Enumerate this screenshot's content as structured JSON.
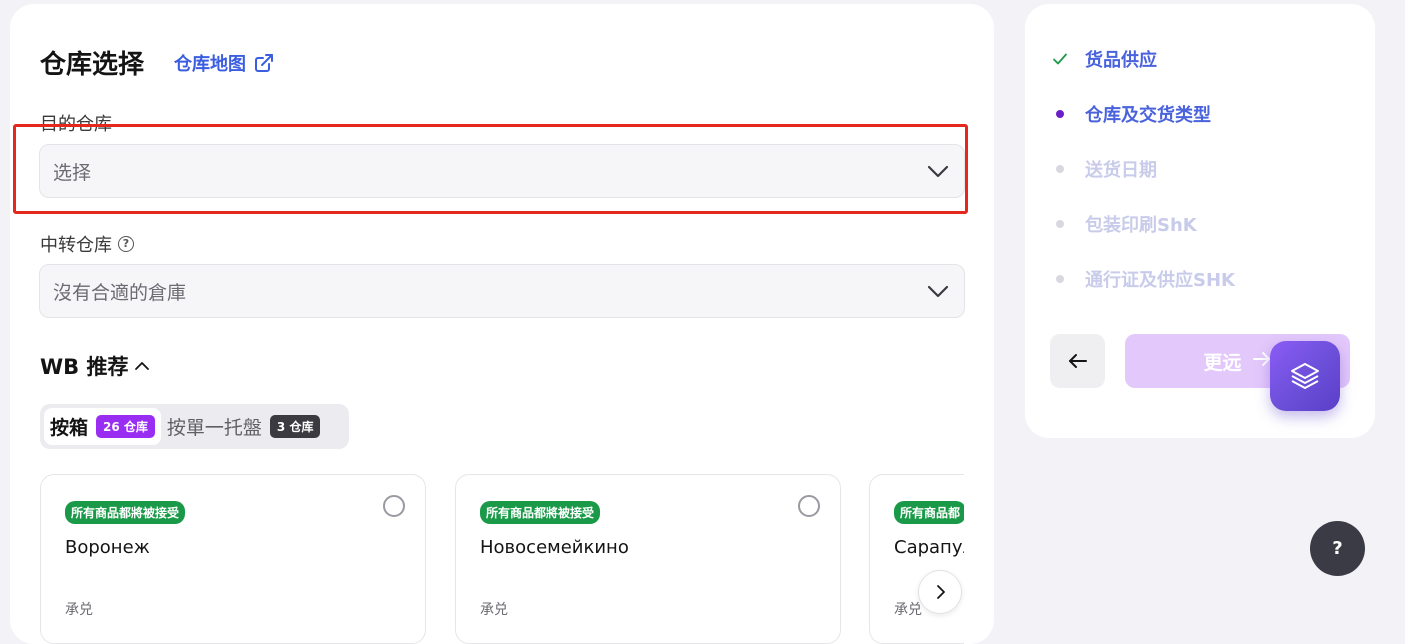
{
  "header": {
    "title": "仓库选择",
    "map_link": "仓库地图"
  },
  "destination": {
    "label": "目的仓库",
    "placeholder": "选择"
  },
  "transit": {
    "label": "中转仓库",
    "help": "?",
    "value": "沒有合適的倉庫"
  },
  "recommend": {
    "title": "WB 推荐"
  },
  "tabs": [
    {
      "label": "按箱",
      "badge": "26 仓库"
    },
    {
      "label": "按單一托盤",
      "badge": "3 仓库"
    }
  ],
  "cards": [
    {
      "tag": "所有商品都將被接受",
      "name": "Воронеж",
      "accept": "承兑"
    },
    {
      "tag": "所有商品都將被接受",
      "name": "Новосемейкино",
      "accept": "承兑"
    },
    {
      "tag": "所有商品都",
      "name": "Сарапул",
      "accept": "承兑"
    }
  ],
  "steps": [
    {
      "label": "货品供应",
      "state": "done"
    },
    {
      "label": "仓库及交货类型",
      "state": "current"
    },
    {
      "label": "送货日期",
      "state": "pending"
    },
    {
      "label": "包装印刷ShK",
      "state": "pending"
    },
    {
      "label": "通行证及供应SHK",
      "state": "pending"
    }
  ],
  "nav": {
    "next_label": "更远",
    "help_label": "?"
  },
  "colors": {
    "accent": "#4a63dd",
    "purple": "#9a2df2",
    "green": "#1a9a48",
    "highlight": "#e5281e"
  },
  "icons": [
    "external-link-icon",
    "chevron-down-icon",
    "chevron-up-icon",
    "check-icon",
    "arrow-left-icon",
    "arrow-right-icon",
    "layers-icon",
    "chevron-right-icon"
  ]
}
